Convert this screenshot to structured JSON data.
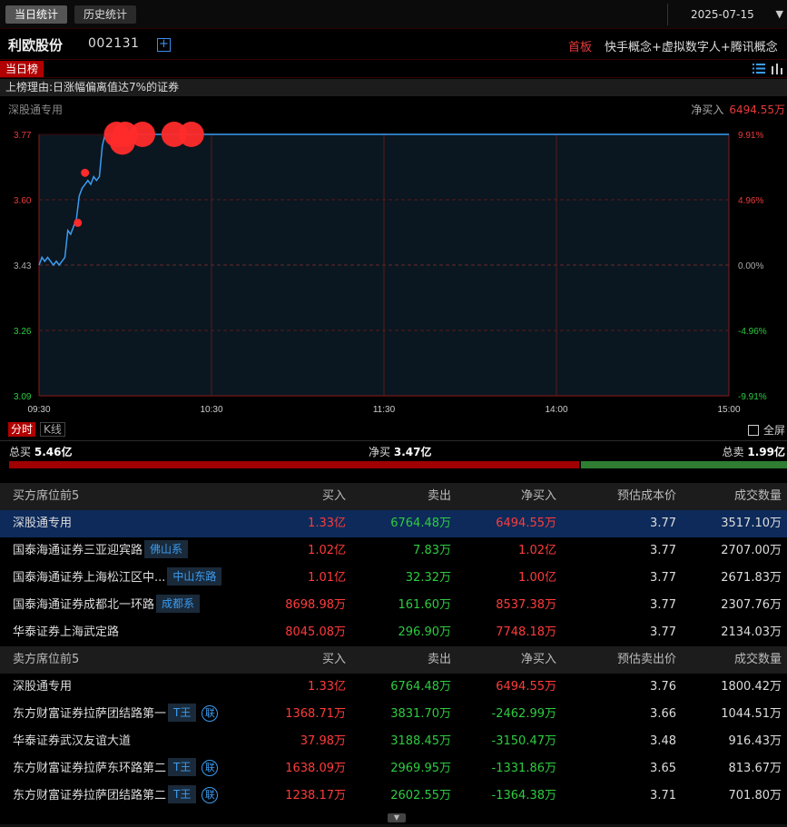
{
  "top_tabs": [
    {
      "label": "当日统计",
      "active": true
    },
    {
      "label": "历史统计",
      "active": false
    }
  ],
  "date": "2025-07-15",
  "stock": {
    "name": "利欧股份",
    "code": "002131",
    "add_icon": "plus-square-icon",
    "board": "首板",
    "concepts": "快手概念+虚拟数字人+腾讯概念"
  },
  "list_tab": "当日榜",
  "reason": "上榜理由:日涨幅偏离值达7%的证券",
  "seat_label": "深股通专用",
  "net_buy": {
    "label": "净买入",
    "value": "6494.55万"
  },
  "chart_tabs": {
    "fenshi": "分时",
    "kline": "K线",
    "fullscreen": "全屏"
  },
  "totals": {
    "buy_label": "总买",
    "buy_value": "5.46亿",
    "net_label": "净买",
    "net_value": "3.47亿",
    "sell_label": "总卖",
    "sell_value": "1.99亿",
    "buy_share": 0.733
  },
  "colors": {
    "up": "#ff3b3b",
    "down": "#2ecc40",
    "accent": "#3b9cf0",
    "price_line": "#3b9cf0"
  },
  "chart_data": {
    "type": "line",
    "y_ticks_left": [
      "3.77",
      "3.60",
      "3.43",
      "3.26",
      "3.09"
    ],
    "y_ticks_right": [
      "9.91%",
      "4.96%",
      "0.00%",
      "-4.96%",
      "-9.91%"
    ],
    "x_ticks": [
      "09:30",
      "10:30",
      "11:30",
      "14:00",
      "15:00"
    ],
    "ylim": [
      3.09,
      3.77
    ],
    "x_minutes_total": 240,
    "x": [
      0,
      1,
      2,
      3,
      4,
      5,
      6,
      7,
      8,
      9,
      10,
      11,
      12,
      13,
      14,
      15,
      16,
      17,
      18,
      19,
      20,
      21,
      22,
      23,
      24,
      25,
      240
    ],
    "y": [
      3.43,
      3.45,
      3.44,
      3.45,
      3.44,
      3.43,
      3.44,
      3.43,
      3.44,
      3.45,
      3.52,
      3.51,
      3.53,
      3.55,
      3.61,
      3.63,
      3.64,
      3.65,
      3.64,
      3.66,
      3.65,
      3.66,
      3.74,
      3.77,
      3.77,
      3.77,
      3.77
    ],
    "markers": [
      {
        "x": 13.5,
        "y": 3.54,
        "size": "small"
      },
      {
        "x": 16.0,
        "y": 3.67,
        "size": "small"
      },
      {
        "x": 27.0,
        "y": 3.77,
        "size": "large"
      },
      {
        "x": 30.0,
        "y": 3.77,
        "size": "large"
      },
      {
        "x": 29.0,
        "y": 3.75,
        "size": "large"
      },
      {
        "x": 36.0,
        "y": 3.77,
        "size": "large"
      },
      {
        "x": 47.0,
        "y": 3.77,
        "size": "large"
      },
      {
        "x": 53.0,
        "y": 3.77,
        "size": "large"
      }
    ]
  },
  "buy_table": {
    "headers": [
      "买方席位前5",
      "买入",
      "卖出",
      "净买入",
      "预估成本价",
      "成交数量"
    ],
    "rows": [
      {
        "name": "深股通专用",
        "tag": "",
        "lian": false,
        "buy": "1.33亿",
        "sell": "6764.48万",
        "net": "6494.55万",
        "net_sign": "up",
        "cost": "3.77",
        "volume": "3517.10万",
        "selected": true
      },
      {
        "name": "国泰海通证券三亚迎宾路",
        "tag": "佛山系",
        "lian": false,
        "buy": "1.02亿",
        "sell": "7.83万",
        "net": "1.02亿",
        "net_sign": "up",
        "cost": "3.77",
        "volume": "2707.00万",
        "selected": false
      },
      {
        "name": "国泰海通证券上海松江区中...",
        "tag": "中山东路",
        "lian": false,
        "buy": "1.01亿",
        "sell": "32.32万",
        "net": "1.00亿",
        "net_sign": "up",
        "cost": "3.77",
        "volume": "2671.83万",
        "selected": false
      },
      {
        "name": "国泰海通证券成都北一环路",
        "tag": "成都系",
        "lian": false,
        "buy": "8698.98万",
        "sell": "161.60万",
        "net": "8537.38万",
        "net_sign": "up",
        "cost": "3.77",
        "volume": "2307.76万",
        "selected": false
      },
      {
        "name": "华泰证券上海武定路",
        "tag": "",
        "lian": false,
        "buy": "8045.08万",
        "sell": "296.90万",
        "net": "7748.18万",
        "net_sign": "up",
        "cost": "3.77",
        "volume": "2134.03万",
        "selected": false
      }
    ]
  },
  "sell_table": {
    "headers": [
      "卖方席位前5",
      "买入",
      "卖出",
      "净买入",
      "预估卖出价",
      "成交数量"
    ],
    "rows": [
      {
        "name": "深股通专用",
        "tag": "",
        "lian": false,
        "buy": "1.33亿",
        "sell": "6764.48万",
        "net": "6494.55万",
        "net_sign": "up",
        "cost": "3.76",
        "volume": "1800.42万",
        "selected": false
      },
      {
        "name": "东方财富证券拉萨团结路第一",
        "tag": "T王",
        "lian": true,
        "buy": "1368.71万",
        "sell": "3831.70万",
        "net": "-2462.99万",
        "net_sign": "down",
        "cost": "3.66",
        "volume": "1044.51万",
        "selected": false
      },
      {
        "name": "华泰证券武汉友谊大道",
        "tag": "",
        "lian": false,
        "buy": "37.98万",
        "sell": "3188.45万",
        "net": "-3150.47万",
        "net_sign": "down",
        "cost": "3.48",
        "volume": "916.43万",
        "selected": false
      },
      {
        "name": "东方财富证券拉萨东环路第二",
        "tag": "T王",
        "lian": true,
        "buy": "1638.09万",
        "sell": "2969.95万",
        "net": "-1331.86万",
        "net_sign": "down",
        "cost": "3.65",
        "volume": "813.67万",
        "selected": false
      },
      {
        "name": "东方财富证券拉萨团结路第二",
        "tag": "T王",
        "lian": true,
        "buy": "1238.17万",
        "sell": "2602.55万",
        "net": "-1364.38万",
        "net_sign": "down",
        "cost": "3.71",
        "volume": "701.80万",
        "selected": false
      }
    ],
    "lian_label": "联"
  }
}
